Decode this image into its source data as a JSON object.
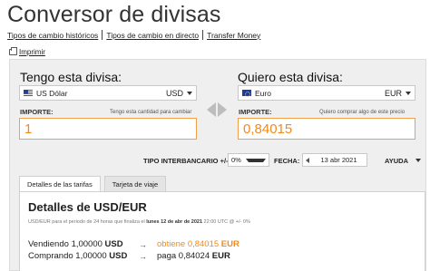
{
  "page_title": "Conversor de divisas",
  "subnav": {
    "items": [
      {
        "label": "Tipos de cambio históricos"
      },
      {
        "label": "Tipos de cambio en directo"
      },
      {
        "label": "Transfer Money"
      }
    ]
  },
  "print_label": "Imprimir",
  "converter": {
    "from": {
      "heading": "Tengo esta divisa:",
      "currency_name": "US Dólar",
      "currency_code": "USD",
      "amount_label": "IMPORTE:",
      "amount_hint": "Tengo esta cantidad para cambiar",
      "amount_value": "1"
    },
    "to": {
      "heading": "Quiero esta divisa:",
      "currency_name": "Euro",
      "currency_code": "EUR",
      "amount_label": "IMPORTE:",
      "amount_hint": "Quiero comprar algo de este precio",
      "amount_value": "0,84015"
    },
    "options": {
      "rate_label": "TIPO INTERBANCARIO +/-",
      "rate_value": "0%",
      "date_label": "FECHA:",
      "date_value": "13 abr 2021",
      "help_label": "AYUDA"
    }
  },
  "tabs": [
    {
      "label": "Detalles de las tarifas"
    },
    {
      "label": "Tarjeta de viaje"
    }
  ],
  "details": {
    "title": "Detalles de USD/EUR",
    "note_prefix": "USD/EUR para el periodo de 24 horas que finaliza el",
    "note_date": "lunes 12 de abr de 2021",
    "note_suffix": "22:00 UTC @ +/- 0%",
    "sell": {
      "verb": "Vendiendo",
      "amount": "1,00000",
      "code_from": "USD",
      "arrow": "→",
      "result_verb": "obtiene",
      "result": "0,84015",
      "code_to": "EUR"
    },
    "buy": {
      "verb": "Comprando",
      "amount": "1,00000",
      "code_from": "USD",
      "arrow": "→",
      "result_verb": "paga",
      "result": "0,84024",
      "code_to": "EUR"
    }
  },
  "colors": {
    "accent_orange": "#f08a1c",
    "panel_bg": "#efefef"
  }
}
